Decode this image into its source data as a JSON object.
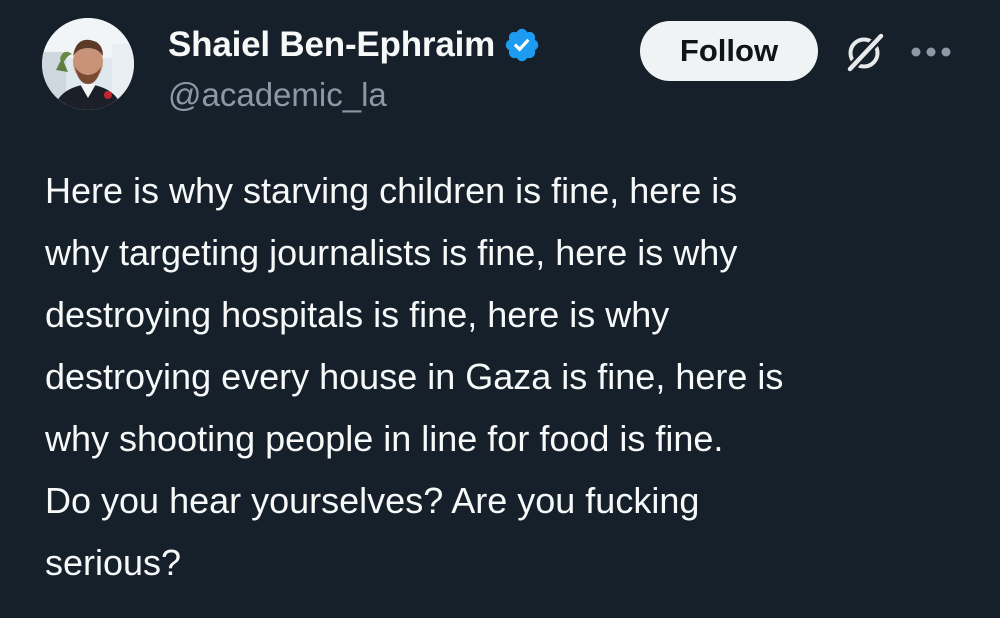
{
  "author": {
    "display_name": "Shaiel Ben-Ephraim",
    "handle": "@academic_la",
    "verified": true,
    "avatar_icon": "profile-photo"
  },
  "actions": {
    "follow_label": "Follow",
    "grok_icon": "grok-slash-icon",
    "more_icon": "ellipsis-icon"
  },
  "tweet": {
    "lines": [
      "Here is why starving children is fine, here is",
      "why targeting journalists is fine, here is why",
      "destroying hospitals is fine, here is why",
      "destroying every house in Gaza is fine, here is",
      "why shooting people in line for food is fine.",
      "Do you hear yourselves? Are you fucking",
      "serious?"
    ]
  },
  "colors": {
    "background": "#15202b",
    "text": "#f7f9f9",
    "secondary_text": "#8b98a5",
    "verified_badge": "#1d9bf0",
    "follow_button_bg": "#eff3f4",
    "follow_button_text": "#0f1419"
  }
}
